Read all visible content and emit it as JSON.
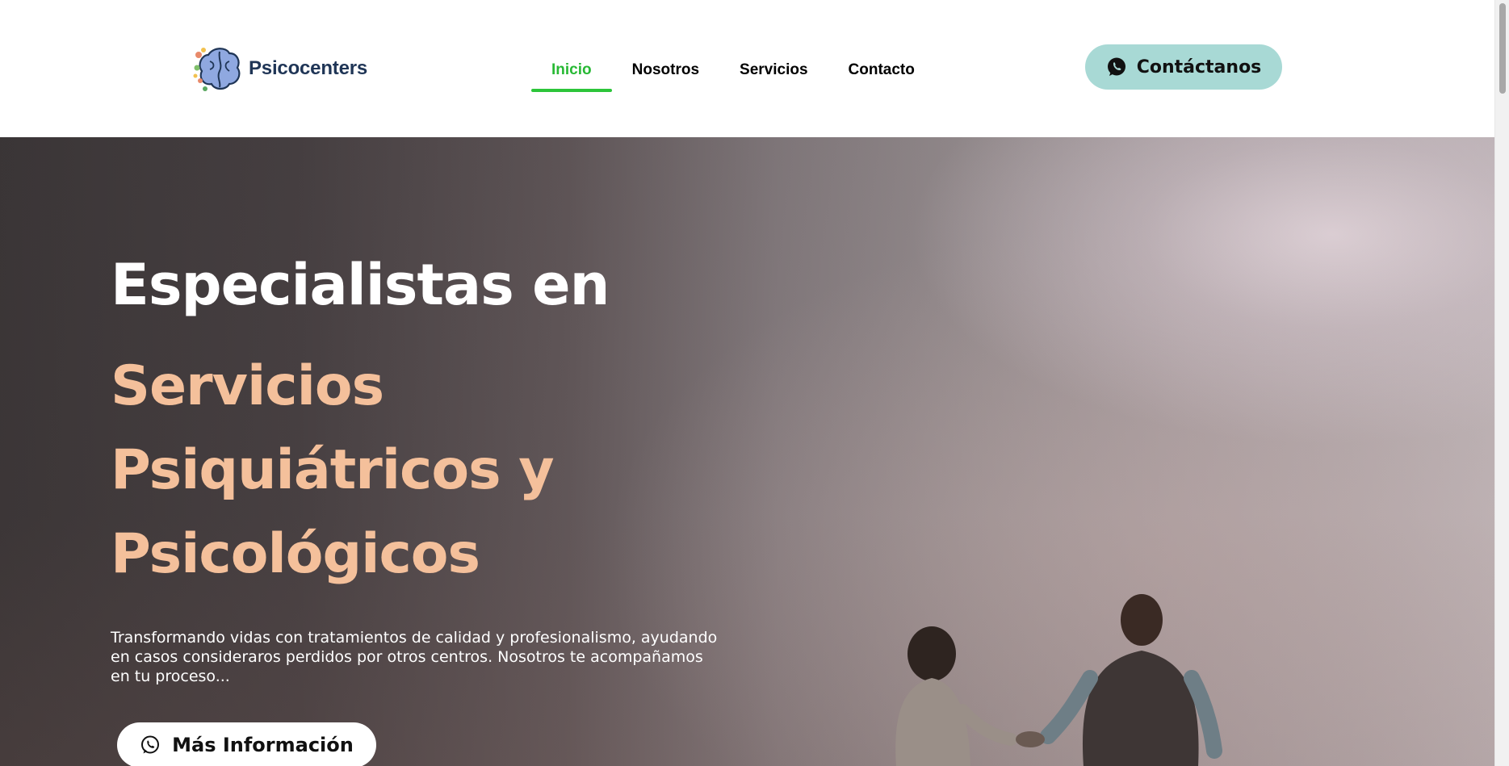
{
  "brand": {
    "name": "Psicocenters",
    "logo_icon": "brain-icon"
  },
  "nav": {
    "items": [
      {
        "label": "Inicio",
        "active": true
      },
      {
        "label": "Nosotros",
        "active": false
      },
      {
        "label": "Servicios",
        "active": false
      },
      {
        "label": "Contacto",
        "active": false
      }
    ]
  },
  "header_cta": {
    "label": "Contáctanos",
    "icon": "whatsapp-icon"
  },
  "hero": {
    "title_line1": "Especialistas en",
    "title_accent": [
      "Servicios",
      "Psiquiátricos y",
      "Psicológicos"
    ],
    "description": "Transformando vidas con tratamientos de calidad y profesionalismo, ayudando en casos consideraros perdidos por otros centros. Nosotros te acompañamos en tu proceso...",
    "cta_label": "Más Información",
    "cta_icon": "whatsapp-icon"
  },
  "colors": {
    "accent_green": "#2cc53a",
    "accent_peach": "#f4c09b",
    "cta_teal": "#a8d9d5",
    "logo_navy": "#1f3556"
  }
}
